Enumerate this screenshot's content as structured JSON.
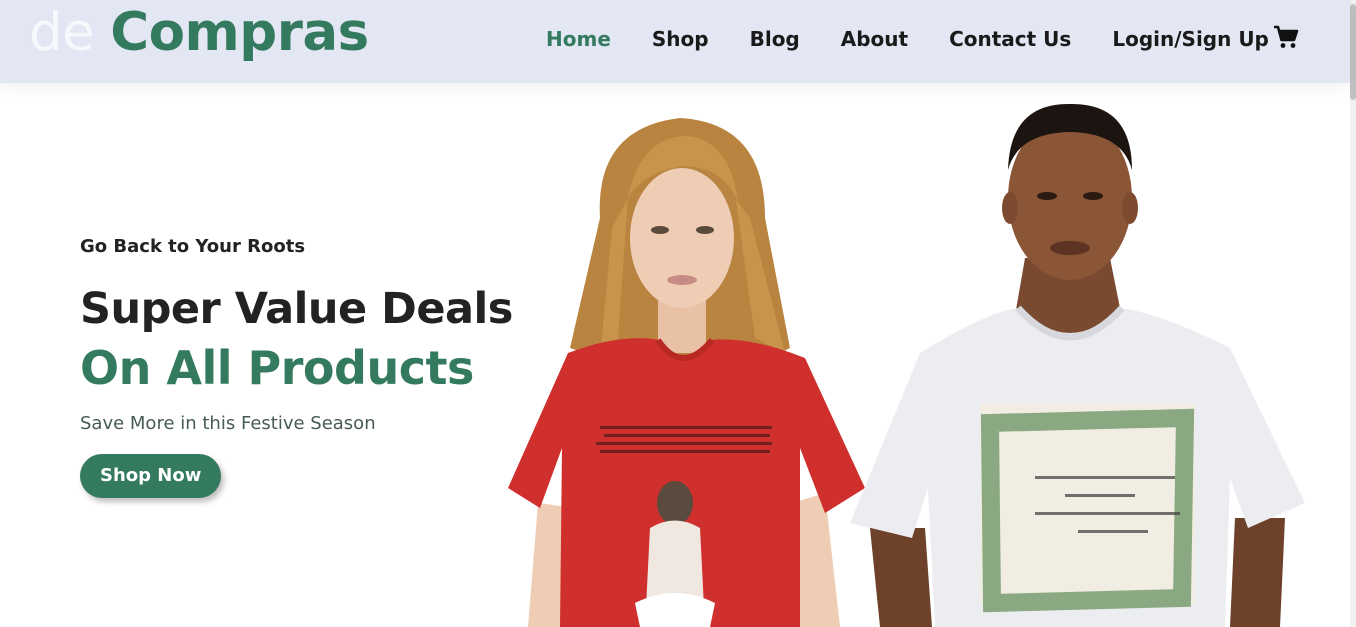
{
  "header": {
    "logo": {
      "prefix": "de",
      "name": "Compras"
    },
    "nav": [
      {
        "label": "Home",
        "active": true
      },
      {
        "label": "Shop",
        "active": false
      },
      {
        "label": "Blog",
        "active": false
      },
      {
        "label": "About",
        "active": false
      },
      {
        "label": "Contact Us",
        "active": false
      },
      {
        "label": "Login/Sign Up",
        "active": false
      }
    ],
    "cart_icon": "shopping-cart-icon"
  },
  "hero": {
    "tagline": "Go Back to Your Roots",
    "headline": "Super Value Deals",
    "headline_accent": "On All Products",
    "subtext": "Save More in this Festive Season",
    "cta_label": "Shop Now"
  },
  "colors": {
    "header_bg": "#e3e6f3",
    "accent": "#347a5f",
    "text_dark": "#222222",
    "red_shirt": "#d0302d",
    "white_shirt": "#ecedf0"
  }
}
